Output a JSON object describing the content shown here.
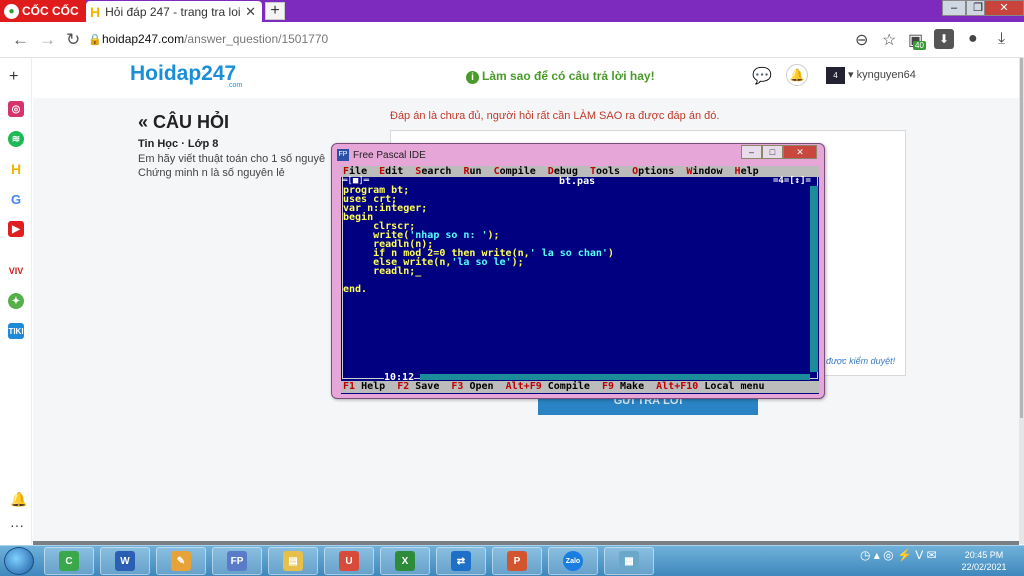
{
  "browser": {
    "brand_label": "CỐC CỐC",
    "tab_title": "Hỏi đáp 247 - trang tra loi",
    "url_host": "hoidap247.com",
    "url_path": "/answer_question/1501770",
    "download_badge": "40"
  },
  "site": {
    "brand": "Hoidap247",
    "brand_sub": ".com",
    "help_text": "Làm sao để có câu trả lời hay!",
    "username": "kynguyen64"
  },
  "question": {
    "heading": "« CÂU HỎI",
    "meta": "Tin Học · Lớp 8",
    "text": "Em hãy viết thuật toán cho 1 số nguyê Chứng minh n là số nguyên lẻ"
  },
  "answer": {
    "warning": "Đáp án là chưa đủ, người hỏi rất cần LÀM SAO ra được đáp án đó.",
    "pending": "được kiểm duyệt!",
    "submit_label": "GỬI TRẢ LỜI"
  },
  "pascal": {
    "window_title": "Free Pascal IDE",
    "menu": [
      "File",
      "Edit",
      "Search",
      "Run",
      "Compile",
      "Debug",
      "Tools",
      "Options",
      "Window",
      "Help"
    ],
    "file_name": "bt.pas",
    "window_number": "=4=[↕]=",
    "frame_left": "═[■]═",
    "code_lines": [
      "program bt;",
      "uses crt;",
      "var n:integer;",
      "begin",
      "     clrscr;",
      "     write('nhap so n: ');",
      "     readln(n);",
      "     if n mod 2=0 then write(n,' la so chan')",
      "     else write(n,'la so le');",
      "     readln;_",
      "",
      "end."
    ],
    "cursor_pos": "10:12",
    "status": [
      {
        "key": "F1",
        "label": "Help"
      },
      {
        "key": "F2",
        "label": "Save"
      },
      {
        "key": "F3",
        "label": "Open"
      },
      {
        "key": "Alt+F9",
        "label": "Compile"
      },
      {
        "key": "F9",
        "label": "Make"
      },
      {
        "key": "Alt+F10",
        "label": "Local menu"
      }
    ]
  },
  "taskbar": {
    "clock_time": "20:45 PM",
    "clock_date": "22/02/2021",
    "apps": [
      "coccoc-icon",
      "word-icon",
      "paint-icon",
      "freepascal-icon",
      "explorer-icon",
      "unikey-icon",
      "excel-icon",
      "teamviewer-icon",
      "powerpoint-icon",
      "zalo-icon",
      "notepad-icon"
    ]
  },
  "colors": {
    "pascal_bg": "#000080",
    "pascal_code": "#ffff55",
    "pascal_string": "#55ffff",
    "taskbar": "#3f88bd",
    "tabbar": "#7d2abf"
  }
}
